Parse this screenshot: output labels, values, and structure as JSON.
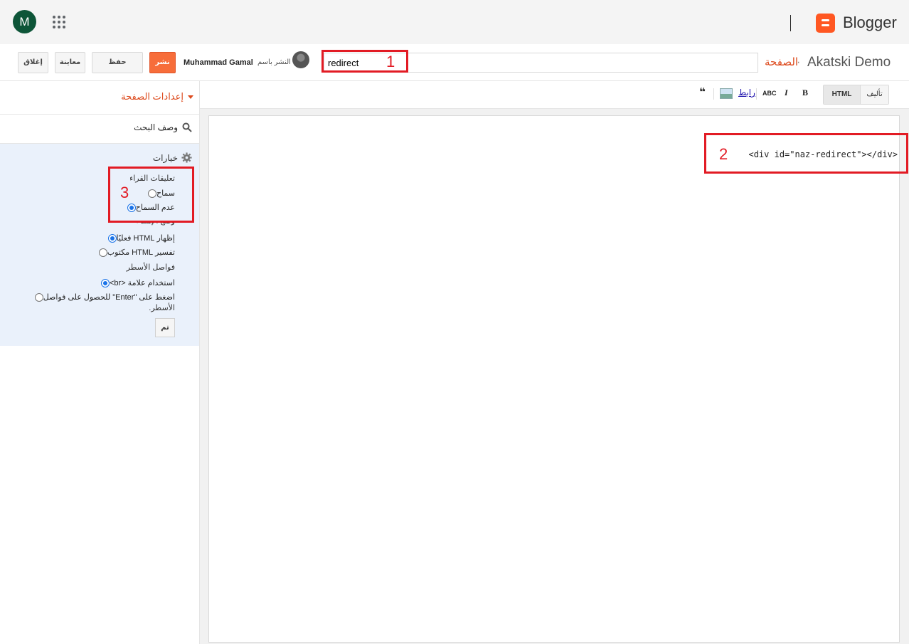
{
  "appbar": {
    "avatar_letter": "M",
    "brand": "Blogger",
    "icons": [
      "apps-grid-icon",
      "blogger-logo-icon"
    ]
  },
  "actionbar": {
    "close_label": "إغلاق",
    "preview_label": "معاينة",
    "save_label": "حفظ",
    "publish_label": "نشر",
    "author_prefix": "النشر باسم",
    "author_name": "Muhammad Gamal",
    "title_value": "redirect",
    "breadcrumb_blog": "Akatski Demo",
    "breadcrumb_sep": "·",
    "breadcrumb_page": "الصفحة"
  },
  "annotations": [
    "1",
    "2",
    "3"
  ],
  "annotation_color": "#e21b24",
  "sidebar": {
    "page_settings": "إعدادات الصفحة",
    "search_description": "وصف البحث",
    "options_title": "خيارات",
    "reader_comments_label": "تعليقات القراء",
    "allow_label": "سماح",
    "disallow_label": "عدم السماح",
    "compose_mode_label": "وضع الإنشاء",
    "show_html_literally": "إظهار HTML فعليًا",
    "interpret_html": "تفسير HTML مكتوب",
    "line_breaks_label": "فواصل الأسطر",
    "use_br_tag": "استخدام علامة <br>",
    "press_enter_line1": "اضغط على \"Enter\" للحصول على فواصل",
    "press_enter_line2": "الأسطر.",
    "done_label": "تم"
  },
  "toolbar": {
    "html_label": "HTML",
    "compose_label": "تأليف",
    "bold": "B",
    "italic": "I",
    "spell_check": "ABC",
    "link_label": "رابط",
    "quote": "❝"
  },
  "editor": {
    "code": "<div id=\"naz-redirect\"></div>"
  },
  "colors": {
    "accent_orange": "#dd4b1e",
    "publish_button": "#f76d3a",
    "options_panel_bg": "#eaf1fb",
    "avatar_bg": "#0d5538"
  }
}
